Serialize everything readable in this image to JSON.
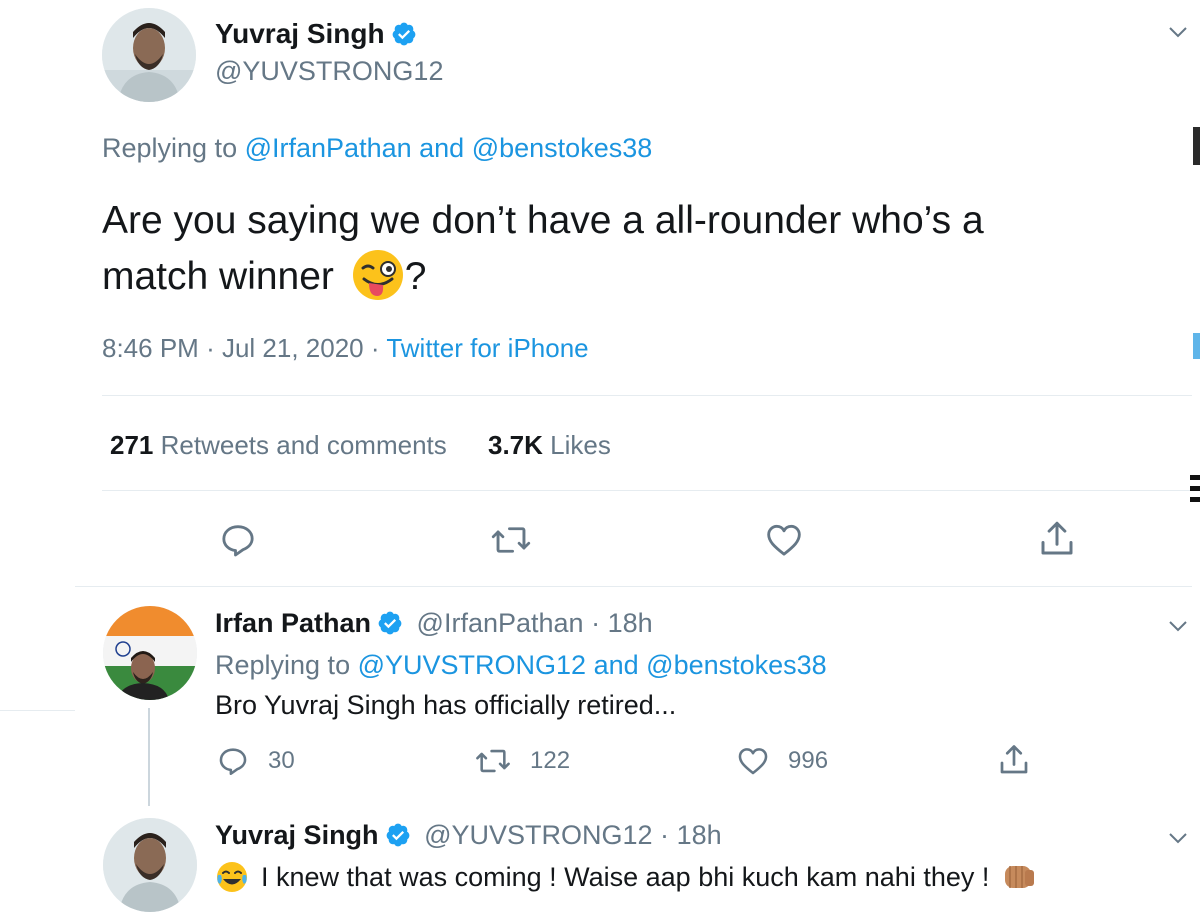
{
  "main_tweet": {
    "author_name": "Yuvraj Singh",
    "handle": "@YUVSTRONG12",
    "replying_prefix": "Replying to",
    "replying_mention_1": "@IrfanPathan",
    "replying_and": "and",
    "replying_mention_2": "@benstokes38",
    "text_line1": "Are you saying we don’t have a all-rounder who’s a",
    "text_line2": "match winner",
    "text_line2_end": "?",
    "time": "8:46 PM",
    "date": "Jul 21, 2020",
    "separator": "·",
    "source": "Twitter for iPhone",
    "retweets_count": "271",
    "retweets_label": "Retweets and comments",
    "likes_count": "3.7K",
    "likes_label": "Likes",
    "emoji": "winking-face-with-tongue"
  },
  "reply_1": {
    "author_name": "Irfan Pathan",
    "handle": "@IrfanPathan",
    "separator": "·",
    "age": "18h",
    "replying_prefix": "Replying to",
    "replying_mention_1": "@YUVSTRONG12",
    "replying_and": "and",
    "replying_mention_2": "@benstokes38",
    "text": "Bro Yuvraj Singh has officially retired...",
    "reply_count": "30",
    "retweet_count": "122",
    "like_count": "996"
  },
  "reply_2": {
    "author_name": "Yuvraj Singh",
    "handle": "@YUVSTRONG12",
    "separator": "·",
    "age": "18h",
    "text": "I knew that was coming ! Waise aap bhi kuch kam nahi they !",
    "emoji_start": "face-with-tears-of-joy",
    "emoji_end": "fist-bump"
  },
  "colors": {
    "text": "#14171a",
    "muted": "#657786",
    "link": "#1b95e0",
    "divider": "#e6ecf0",
    "verified": "#1da1f2"
  }
}
